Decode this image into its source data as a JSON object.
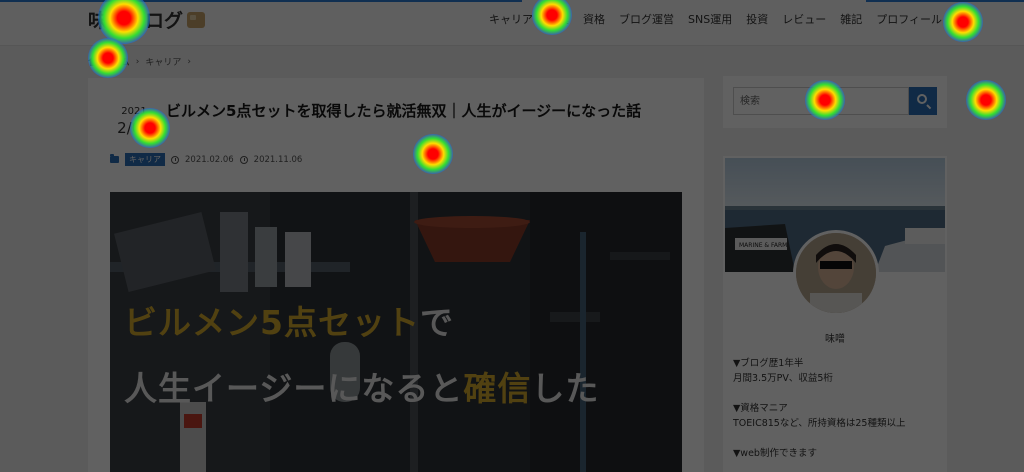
{
  "header": {
    "logo_text": "味噌ブログ",
    "nav": [
      "キャリア",
      "副業",
      "資格",
      "ブログ運営",
      "SNS運用",
      "投資",
      "レビュー",
      "雑記",
      "プロフィール"
    ]
  },
  "breadcrumb": {
    "items": [
      "ホーム",
      "キャリア"
    ]
  },
  "article": {
    "date_year": "2021",
    "date_md": "2/06",
    "title": "ビルメン5点セットを取得したら就活無双｜人生がイージーになった話",
    "category": "キャリア",
    "published": "2021.02.06",
    "updated": "2021.11.06",
    "hero": {
      "line1_gold": "ビルメン5点セット",
      "line1_plain": "で",
      "line2_plain": "人生イージーになると",
      "line2_gold": "確信",
      "line2_end": "した"
    }
  },
  "sidebar": {
    "search": {
      "placeholder": "検索"
    },
    "profile": {
      "banner_sign": "MARINE & FARM",
      "name": "味噌",
      "lines": [
        "▼ブログ歴1年半",
        "月間3.5万PV、収益5桁",
        "",
        "▼資格マニア",
        "TOEIC815など、所持資格は25種類以上",
        "",
        "▼web制作できます"
      ]
    }
  },
  "colors": {
    "accent": "#2a6fb8",
    "hero_gold": "#d4aa2f"
  }
}
